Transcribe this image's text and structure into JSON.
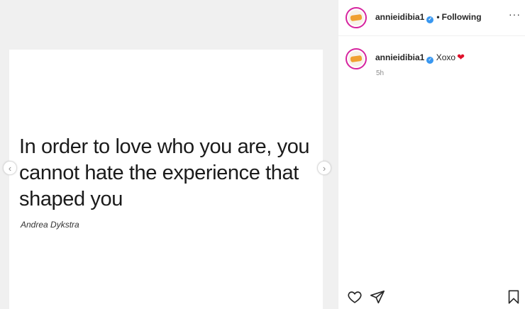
{
  "post": {
    "quote": "In order to love who you are, you cannot hate the experience that shaped you",
    "author": "Andrea Dykstra"
  },
  "nav": {
    "prev_glyph": "‹",
    "next_glyph": "›"
  },
  "header": {
    "username": "annieidibia1",
    "verified_glyph": "✓",
    "separator": "•",
    "follow_status": "Following",
    "more_glyph": "···"
  },
  "comment": {
    "username": "annieidibia1",
    "verified_glyph": "✓",
    "text": "Xoxo",
    "emoji": "❤",
    "time": "5h"
  },
  "icons": {
    "like": "heart-icon",
    "share": "paper-plane-icon",
    "save": "bookmark-icon"
  },
  "colors": {
    "verified": "#3897f0",
    "avatar_ring": "#d6249f",
    "emoji_heart": "#e0112b"
  }
}
